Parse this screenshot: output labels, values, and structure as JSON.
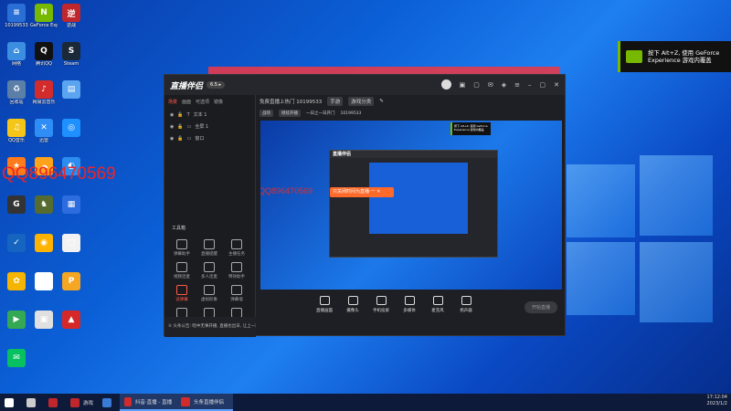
{
  "desktop": {
    "icons": [
      {
        "label": "10199533",
        "color": "#2a6fd6",
        "glyph": "≡"
      },
      {
        "label": "GeForce Experience",
        "color": "#76b900",
        "glyph": "N"
      },
      {
        "label": "逆战",
        "color": "#c0272d",
        "glyph": "逆"
      },
      {
        "label": "网络",
        "color": "#3b8ee0",
        "glyph": "⌂"
      },
      {
        "label": "腾讯QQ",
        "color": "#111111",
        "glyph": "Q"
      },
      {
        "label": "Steam",
        "color": "#1b2838",
        "glyph": "S"
      },
      {
        "label": "回收站",
        "color": "#5c7fa8",
        "glyph": "♻"
      },
      {
        "label": "网易云音乐",
        "color": "#d22b2b",
        "glyph": "♪"
      },
      {
        "label": "",
        "color": "#5ba5f0",
        "glyph": "▤"
      },
      {
        "label": "QQ音乐",
        "color": "#f5c518",
        "glyph": "♫"
      },
      {
        "label": "迅雷",
        "color": "#2f8ef5",
        "glyph": "✕"
      },
      {
        "label": "",
        "color": "#1e90ff",
        "glyph": "◎"
      },
      {
        "label": "",
        "color": "#ff7a1a",
        "glyph": "★"
      },
      {
        "label": "",
        "color": "#ffa31a",
        "glyph": "☁"
      },
      {
        "label": "",
        "color": "#2d8cf0",
        "glyph": "◐"
      },
      {
        "label": "",
        "color": "#333333",
        "glyph": "G"
      },
      {
        "label": "",
        "color": "#556b2f",
        "glyph": "♞"
      },
      {
        "label": "",
        "color": "#2d6cdf",
        "glyph": "▦"
      },
      {
        "label": "",
        "color": "#1565c0",
        "glyph": "✓"
      },
      {
        "label": "",
        "color": "#ffb300",
        "glyph": "◉"
      },
      {
        "label": "",
        "color": "#f2f2f2",
        "glyph": "▢"
      },
      {
        "label": "",
        "color": "#f4b400",
        "glyph": "✿"
      },
      {
        "label": "",
        "color": "#ffffff",
        "glyph": "✍"
      },
      {
        "label": "",
        "color": "#f5a623",
        "glyph": "P"
      },
      {
        "label": "",
        "color": "#34a853",
        "glyph": "▶"
      },
      {
        "label": "",
        "color": "#e0e0e0",
        "glyph": "▣"
      },
      {
        "label": "",
        "color": "#d62828",
        "glyph": "▲"
      },
      {
        "label": "",
        "color": "#07c160",
        "glyph": "✉"
      }
    ],
    "watermark": "QQ896470569",
    "notification": "按下 Alt+Z, 使用 GeForce Experience 游戏内覆盖"
  },
  "window": {
    "logo": "直播伴侣",
    "version_badge": "6.5 ▸",
    "tabs": [
      "场景",
      "画面",
      "可选项",
      "镜像"
    ],
    "sources": [
      "文本 1",
      "全屏 1",
      "窗口"
    ],
    "tools_title": "工具箱",
    "tools": [
      {
        "label": "弹幕助手",
        "sel": false
      },
      {
        "label": "直播提醒",
        "sel": false
      },
      {
        "label": "主播任务",
        "sel": false
      },
      {
        "label": "视频连麦",
        "sel": false
      },
      {
        "label": "多人连麦",
        "sel": false
      },
      {
        "label": "特效助手",
        "sel": false
      },
      {
        "label": "读弹幕",
        "sel": true
      },
      {
        "label": "虚拟形象",
        "sel": false
      },
      {
        "label": "弹幕墙",
        "sel": false
      },
      {
        "label": "",
        "sel": false
      },
      {
        "label": "",
        "sel": false
      },
      {
        "label": "",
        "sel": false
      }
    ],
    "bottom_tip": "⑤ 头条公告: 暗中无事开播, 直播也出日, 让上一家",
    "info": {
      "room_title": "免费直播上热门 10199533",
      "tag": "手游",
      "category_btn": "游戏分类",
      "row2": [
        "战场",
        "继续开播",
        "一日之一日开门",
        "10199533"
      ]
    },
    "nested_logo": "直播伴侣",
    "nested_toast": "只关闭时间为直播·一 ✕",
    "controls": [
      "直播画面",
      "摄像头",
      "手机投屏",
      "多媒体",
      "麦克风",
      "扬声器"
    ],
    "start_label": "开始直播"
  },
  "taskbar": {
    "items": [
      {
        "label": "",
        "color": "#ffffff"
      },
      {
        "label": "",
        "color": "#cccccc"
      },
      {
        "label": "",
        "color": "#c0272d"
      },
      {
        "label": "游戏",
        "color": "#c0272d"
      },
      {
        "label": "",
        "color": "#3a7bd5"
      }
    ],
    "apps": [
      {
        "label": "抖音·直播 - 直播伴侣",
        "color": "#d22b2b"
      },
      {
        "label": "头条直播伴侣",
        "color": "#d22b2b"
      }
    ],
    "time": "17:12:04",
    "date": "2023/1/2"
  }
}
